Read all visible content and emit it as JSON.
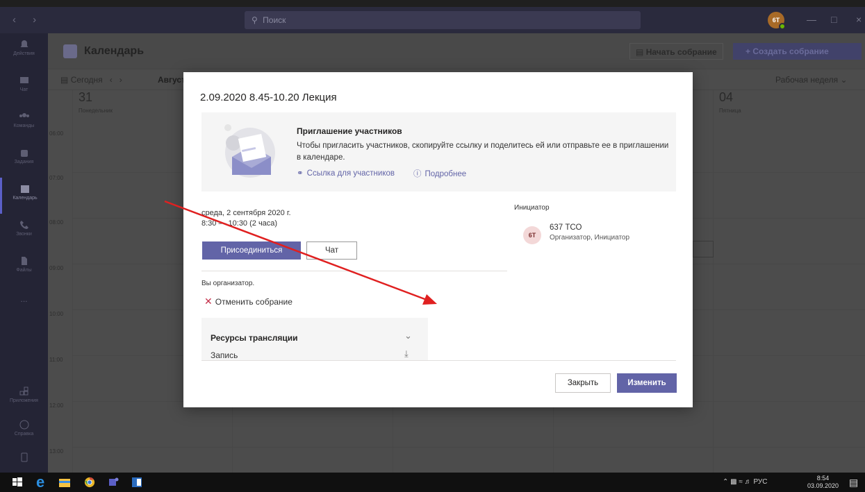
{
  "titlebar": {
    "nav": "‹ ›",
    "search_placeholder": "Поиск",
    "avatar_initials": "6T"
  },
  "rail": [
    {
      "label": "Действия",
      "icon": "bell-icon"
    },
    {
      "label": "Чат",
      "icon": "chat-icon"
    },
    {
      "label": "Команды",
      "icon": "teams-icon"
    },
    {
      "label": "Задания",
      "icon": "assignments-icon"
    },
    {
      "label": "Календарь",
      "icon": "calendar-icon",
      "active": true
    },
    {
      "label": "Звонки",
      "icon": "phone-icon"
    },
    {
      "label": "Файлы",
      "icon": "files-icon"
    },
    {
      "label": "...",
      "icon": "more-icon"
    },
    {
      "label": "Приложения",
      "icon": "apps-icon"
    },
    {
      "label": "Справка",
      "icon": "help-icon"
    }
  ],
  "calendar": {
    "title": "Календарь",
    "start_meeting": "Начать собрание",
    "create_meeting": "+ Создать собрание",
    "today": "Сегодня",
    "month": "Август",
    "view": "Рабочая неделя",
    "days": [
      {
        "num": "31",
        "name": "Понедельник"
      },
      {
        "num": "04",
        "name": "Пятница"
      }
    ],
    "times": [
      "06:00",
      "07:00",
      "08:00",
      "09:00",
      "10:00",
      "11:00",
      "12:00",
      "13:00"
    ]
  },
  "modal": {
    "title": "2.09.2020 8.45-10.20 Лекция",
    "invite_title": "Приглашение участников",
    "invite_text": "Чтобы пригласить участников, скопируйте ссылку и поделитесь ей или отправьте ее в приглашении в календаре.",
    "link_participants": "Ссылка для участников",
    "learn_more": "Подробнее",
    "date": "среда, 2 сентября 2020 г.",
    "time": "8:30 — 10:30 (2 часа)",
    "join": "Присоединиться",
    "chat": "Чат",
    "organizer_note": "Вы организатор.",
    "cancel_meeting": "Отменить собрание",
    "resources_title": "Ресурсы трансляции",
    "recording": "Запись",
    "initiator_label": "Инициатор",
    "initiator_initials": "6T",
    "initiator_name": "637 ТСО",
    "initiator_role": "Организатор, Инициатор",
    "close": "Закрыть",
    "edit": "Изменить"
  },
  "taskbar": {
    "lang": "РУС",
    "time": "8:54",
    "date": "03.09.2020"
  },
  "colors": {
    "accent": "#6264a7",
    "arrow": "#e02020"
  }
}
